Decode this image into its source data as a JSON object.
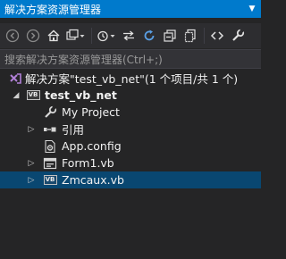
{
  "window": {
    "title": "解决方案资源管理器"
  },
  "toolbar": {
    "buttons": [
      "back-icon",
      "forward-icon",
      "home-icon",
      "switch-views-icon",
      "pending-changes-filter-icon",
      "sync-with-active-document-icon",
      "refresh-icon",
      "collapse-all-icon",
      "show-all-files-icon",
      "view-code-icon",
      "properties-icon"
    ]
  },
  "search": {
    "placeholder": "搜索解决方案资源管理器(Ctrl+;)"
  },
  "tree": {
    "solution": "解决方案\"test_vb_net\"(1 个项目/共 1 个)",
    "project": "test_vb_net",
    "project_badge": "VB",
    "items": {
      "my_project": "My Project",
      "references": "引用",
      "app_config": "App.config",
      "form1": "Form1.vb",
      "zmcaux": "Zmcaux.vb"
    },
    "file_badge": "VB",
    "selected": "Zmcaux.vb"
  },
  "colors": {
    "title_bar": "#007acc",
    "background": "#252526",
    "toolbar": "#2d2d30",
    "selection": "#094771",
    "text": "#f1f1f1"
  }
}
